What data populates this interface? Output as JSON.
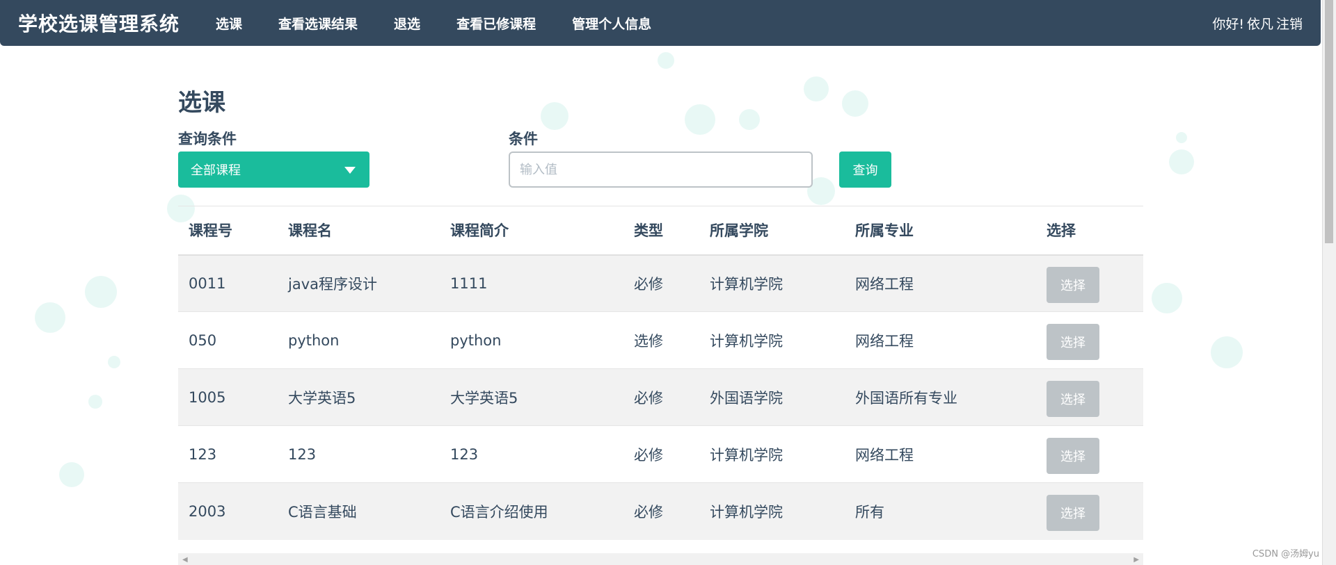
{
  "navbar": {
    "brand": "学校选课管理系统",
    "items": [
      {
        "label": "选课"
      },
      {
        "label": "查看选课结果"
      },
      {
        "label": "退选"
      },
      {
        "label": "查看已修课程"
      },
      {
        "label": "管理个人信息"
      }
    ],
    "greeting": "你好!",
    "username": "依凡",
    "logout": "注销"
  },
  "main": {
    "title": "选课",
    "query_condition_label": "查询条件",
    "select_value": "全部课程",
    "condition_label": "条件",
    "input_placeholder": "输入值",
    "query_button": "查询"
  },
  "table": {
    "headers": [
      "课程号",
      "课程名",
      "课程简介",
      "类型",
      "所属学院",
      "所属专业",
      "选择"
    ],
    "rows": [
      {
        "id": "0011",
        "name": "java程序设计",
        "intro": "1111",
        "type": "必修",
        "college": "计算机学院",
        "major": "网络工程",
        "action": "选择"
      },
      {
        "id": "050",
        "name": "python",
        "intro": "python",
        "type": "选修",
        "college": "计算机学院",
        "major": "网络工程",
        "action": "选择"
      },
      {
        "id": "1005",
        "name": "大学英语5",
        "intro": "大学英语5",
        "type": "必修",
        "college": "外国语学院",
        "major": "外国语所有专业",
        "action": "选择"
      },
      {
        "id": "123",
        "name": "123",
        "intro": "123",
        "type": "必修",
        "college": "计算机学院",
        "major": "网络工程",
        "action": "选择"
      },
      {
        "id": "2003",
        "name": "C语言基础",
        "intro": "C语言介绍使用",
        "type": "必修",
        "college": "计算机学院",
        "major": "所有",
        "action": "选择"
      }
    ]
  },
  "watermark": "CSDN @汤姆yu",
  "colors": {
    "navbar": "#34495e",
    "accent": "#1abc9c",
    "disabled_button": "#bdc3c7"
  }
}
